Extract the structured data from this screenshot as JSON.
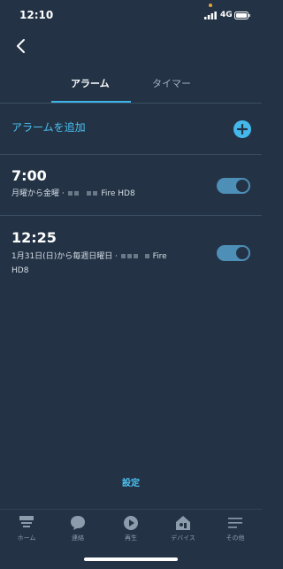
{
  "status_bar": {
    "time": "12:10",
    "network": "4G"
  },
  "tabs": [
    {
      "label": "アラーム",
      "active": true
    },
    {
      "label": "タイマー",
      "active": false
    }
  ],
  "add_alarm": {
    "label": "アラームを追加"
  },
  "alarms": [
    {
      "time": "7:00",
      "schedule": "月曜から金曜 ·",
      "device_end": "Fire HD8",
      "enabled": true
    },
    {
      "time": "12:25",
      "schedule": "1月31日(日)から毎週日曜日 ·",
      "device_end": "Fire",
      "device_line2": "HD8",
      "enabled": true
    }
  ],
  "settings_label": "設定",
  "nav": [
    {
      "label": "ホーム",
      "icon": "home-icon"
    },
    {
      "label": "連絡",
      "icon": "chat-bubble-icon"
    },
    {
      "label": "再生",
      "icon": "play-icon"
    },
    {
      "label": "デバイス",
      "icon": "devices-icon"
    },
    {
      "label": "その他",
      "icon": "menu-icon"
    }
  ],
  "colors": {
    "background": "#233345",
    "accent": "#4bc0f0",
    "toggle_on": "#4d8fb7"
  }
}
